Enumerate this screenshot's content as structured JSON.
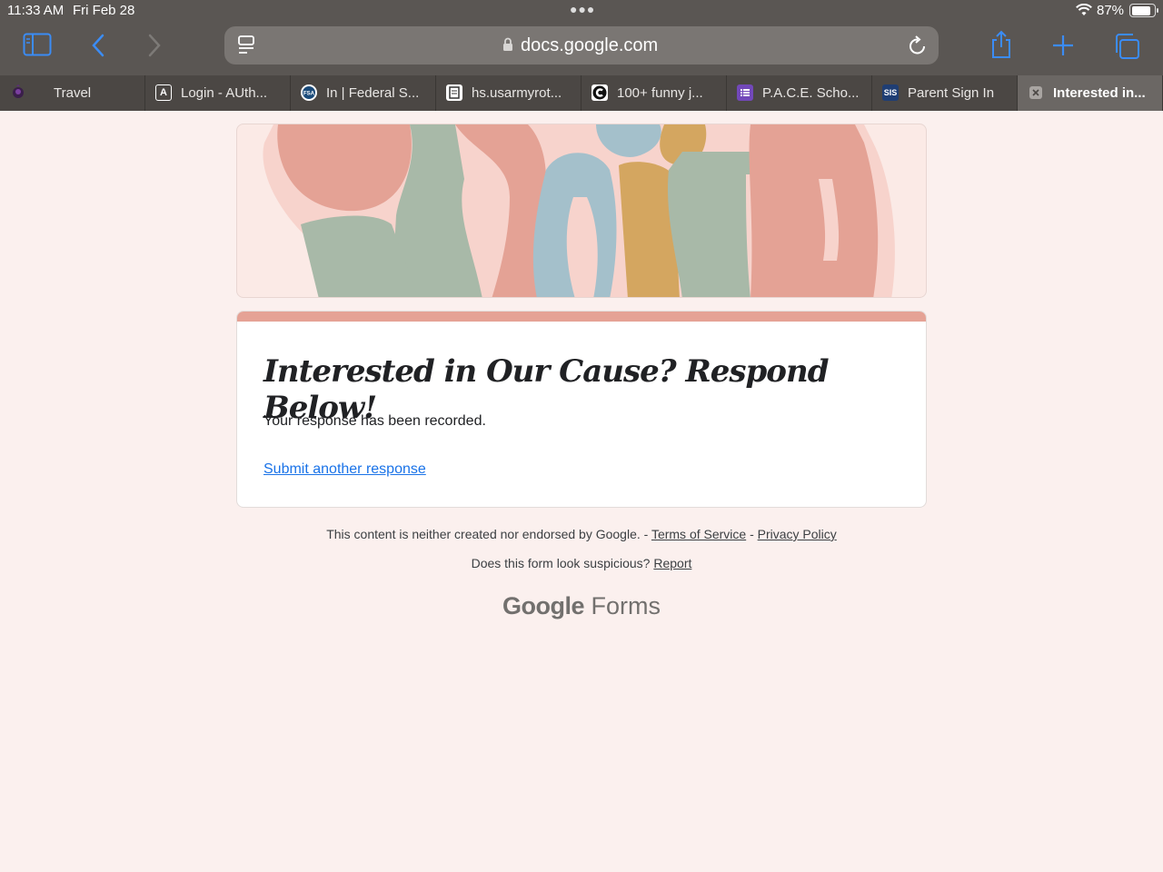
{
  "status_bar": {
    "time": "11:33 AM",
    "date": "Fri Feb 28",
    "battery": "87%",
    "battery_level": 0.87
  },
  "toolbar": {
    "url": "docs.google.com"
  },
  "tabs": [
    {
      "label": "Travel",
      "favicon": "dark-flower-icon",
      "active": false
    },
    {
      "label": "Login - AUth...",
      "favicon": "A",
      "active": false
    },
    {
      "label": "In | Federal S...",
      "favicon": "FSA",
      "active": false
    },
    {
      "label": "hs.usarmyrot...",
      "favicon": "document-icon",
      "active": false
    },
    {
      "label": "100+ funny j...",
      "favicon": "C",
      "active": false
    },
    {
      "label": "P.A.C.E. Scho...",
      "favicon": "forms-list-icon",
      "active": false
    },
    {
      "label": "Parent Sign In",
      "favicon": "SIS",
      "active": false
    },
    {
      "label": "Interested in...",
      "favicon": "close-icon",
      "active": true
    }
  ],
  "form": {
    "title": "Interested in Our Cause? Respond Below!",
    "message": "Your response has been recorded.",
    "submit_another": "Submit another response",
    "accent_color": "#e5a295"
  },
  "footer": {
    "disclaimer": "This content is neither created nor endorsed by Google. -",
    "terms": "Terms of Service",
    "separator": "-",
    "privacy": "Privacy Policy",
    "suspicious": "Does this form look suspicious?",
    "report": "Report",
    "brand_google": "Google",
    "brand_forms": "Forms"
  }
}
